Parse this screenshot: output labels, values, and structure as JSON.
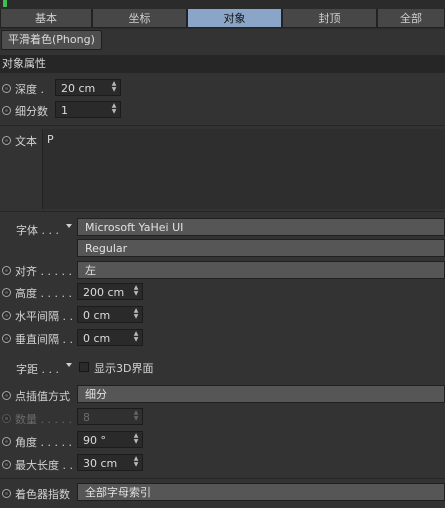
{
  "tabs": [
    {
      "label": "基本"
    },
    {
      "label": "坐标"
    },
    {
      "label": "对象"
    },
    {
      "label": "封顶"
    },
    {
      "label": "全部"
    }
  ],
  "phong_label": "平滑着色(Phong)",
  "section_title": "对象属性",
  "depth": {
    "label": "深度 .",
    "value": "20 cm"
  },
  "subdivision": {
    "label": "细分数",
    "value": "1"
  },
  "text": {
    "label": "文本",
    "value": "P"
  },
  "font": {
    "label": "字体 . . .",
    "family": "Microsoft YaHei UI",
    "style": "Regular"
  },
  "align": {
    "label": "对齐 . . . . .",
    "value": "左"
  },
  "height": {
    "label": "高度 . . . . .",
    "value": "200 cm"
  },
  "h_spacing": {
    "label": "水平间隔 . .",
    "value": "0 cm"
  },
  "v_spacing": {
    "label": "垂直间隔 . .",
    "value": "0 cm"
  },
  "kerning": {
    "label": "字距 . . .",
    "checkbox_label": "显示3D界面"
  },
  "interp": {
    "label": "点插值方式",
    "value": "细分"
  },
  "count": {
    "label": "数量 . . . . .",
    "value": "8"
  },
  "angle": {
    "label": "角度 . . . . .",
    "value": "90 °"
  },
  "max_len": {
    "label": "最大长度 . .",
    "value": "30 cm"
  },
  "shader_index": {
    "label": "着色器指数",
    "value": "全部字母索引"
  },
  "colors": {
    "active_tab": "#8ba5c8",
    "accent_green": "#3fbf4f"
  }
}
